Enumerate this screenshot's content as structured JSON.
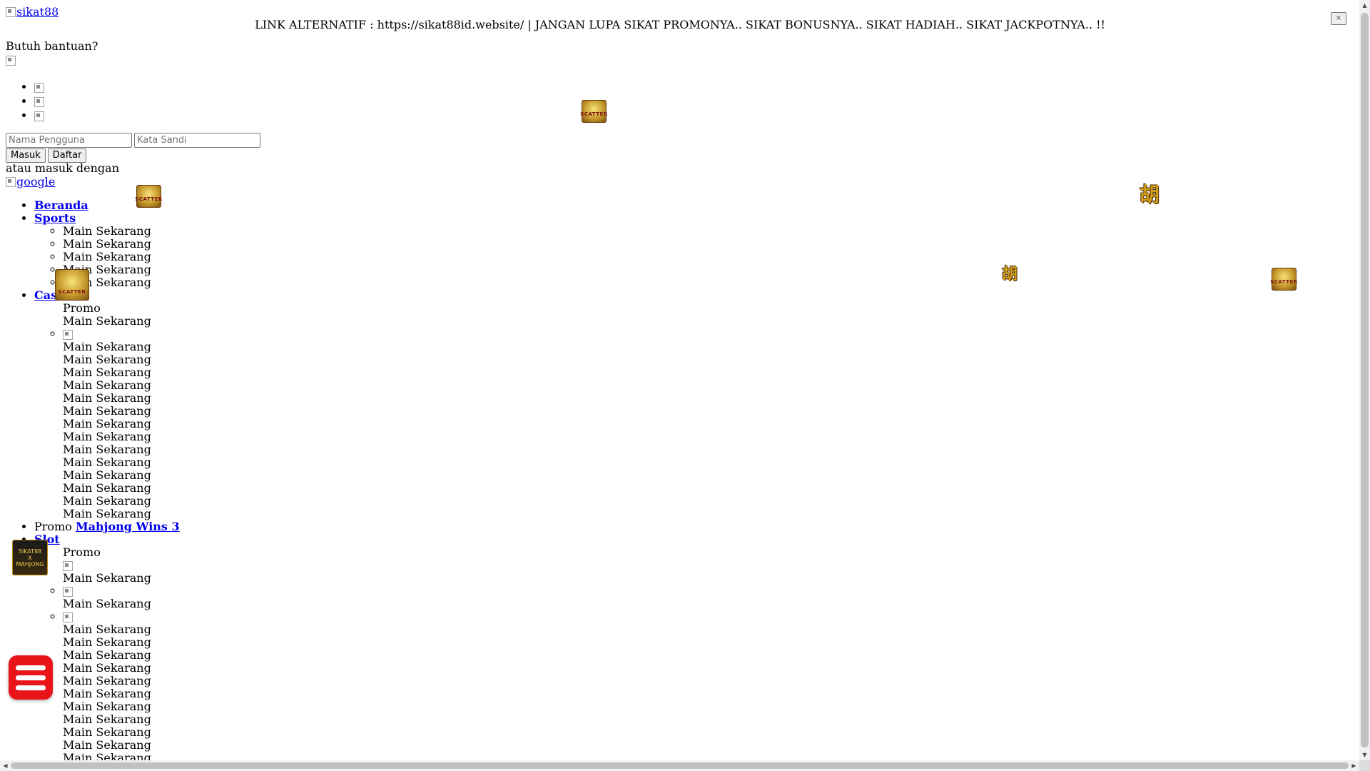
{
  "header": {
    "logo_alt": "sikat88",
    "announcement": "LINK ALTERNATIF : https://sikat88id.website/ | JANGAN LUPA SIKAT PROMONYA.. SIKAT BONUSNYA.. SIKAT HADIAH.. SIKAT JACKPOTNYA.. !!",
    "close_label": "×"
  },
  "help": {
    "label": "Butuh bantuan?"
  },
  "login": {
    "username_placeholder": "Nama Pengguna",
    "password_placeholder": "Kata Sandi",
    "login_button": "Masuk",
    "register_button": "Daftar",
    "alt_text": "atau masuk dengan",
    "google_alt": "google"
  },
  "nav": {
    "home": "Beranda",
    "sports": "Sports",
    "sports_items": [
      "Main Sekarang",
      "Main Sekarang",
      "Main Sekarang",
      "Main Sekarang",
      "Main Sekarang"
    ],
    "casino": "Casino",
    "casino_promo": "Promo",
    "casino_first_play": "Main Sekarang",
    "casino_items": [
      "Main Sekarang",
      "Main Sekarang",
      "Main Sekarang",
      "Main Sekarang",
      "Main Sekarang",
      "Main Sekarang",
      "Main Sekarang",
      "Main Sekarang",
      "Main Sekarang",
      "Main Sekarang",
      "Main Sekarang",
      "Main Sekarang",
      "Main Sekarang",
      "Main Sekarang"
    ],
    "promo_label": "Promo",
    "promo_link": "Mahjong Wins 3",
    "slot": "Slot",
    "slot_promo": "Promo",
    "slot_img_items": [
      "Main Sekarang",
      "Main Sekarang",
      "Main Sekarang"
    ],
    "slot_items": [
      "Main Sekarang",
      "Main Sekarang",
      "Main Sekarang",
      "Main Sekarang",
      "Main Sekarang",
      "Main Sekarang",
      "Main Sekarang",
      "Main Sekarang",
      "Main Sekarang",
      "Main Sekarang"
    ]
  },
  "decor": {
    "scatter_label": "SCATTER",
    "hu_glyph": "胡",
    "mahjong_title": "SIKAT88",
    "mahjong_x": "X",
    "mahjong_game": "MAHJONG"
  },
  "colors": {
    "link": "#0000ee",
    "fab": "#e8141a",
    "scatter_gold": "#c79a2b"
  }
}
